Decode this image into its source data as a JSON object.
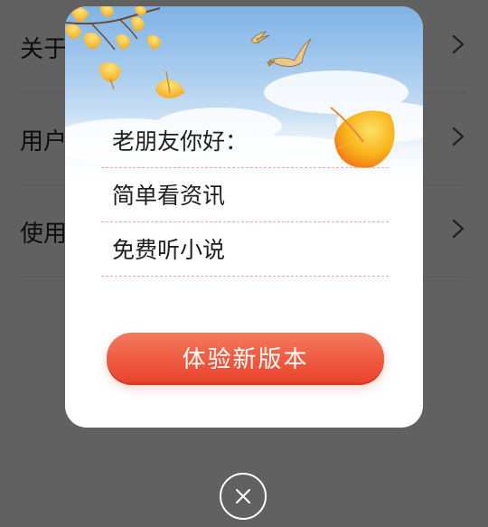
{
  "settings": {
    "items": [
      {
        "label": "关于",
        "icon": "chevron-right-icon"
      },
      {
        "label": "用户",
        "icon": "chevron-right-icon"
      },
      {
        "label": "使用",
        "icon": "chevron-right-icon"
      }
    ]
  },
  "dialog": {
    "lines": [
      "老朋友你好：",
      "简单看资讯",
      "免费听小说"
    ],
    "button_label": "体验新版本",
    "decorations": [
      "ginkgo-leaf-icon",
      "bird-icon"
    ],
    "colors": {
      "button": "#ee5a3f",
      "line_divider": "#eba9a9",
      "sky": "#9fc5ea",
      "leaf": "#f7b21c"
    }
  },
  "close": {
    "icon": "close-icon"
  }
}
